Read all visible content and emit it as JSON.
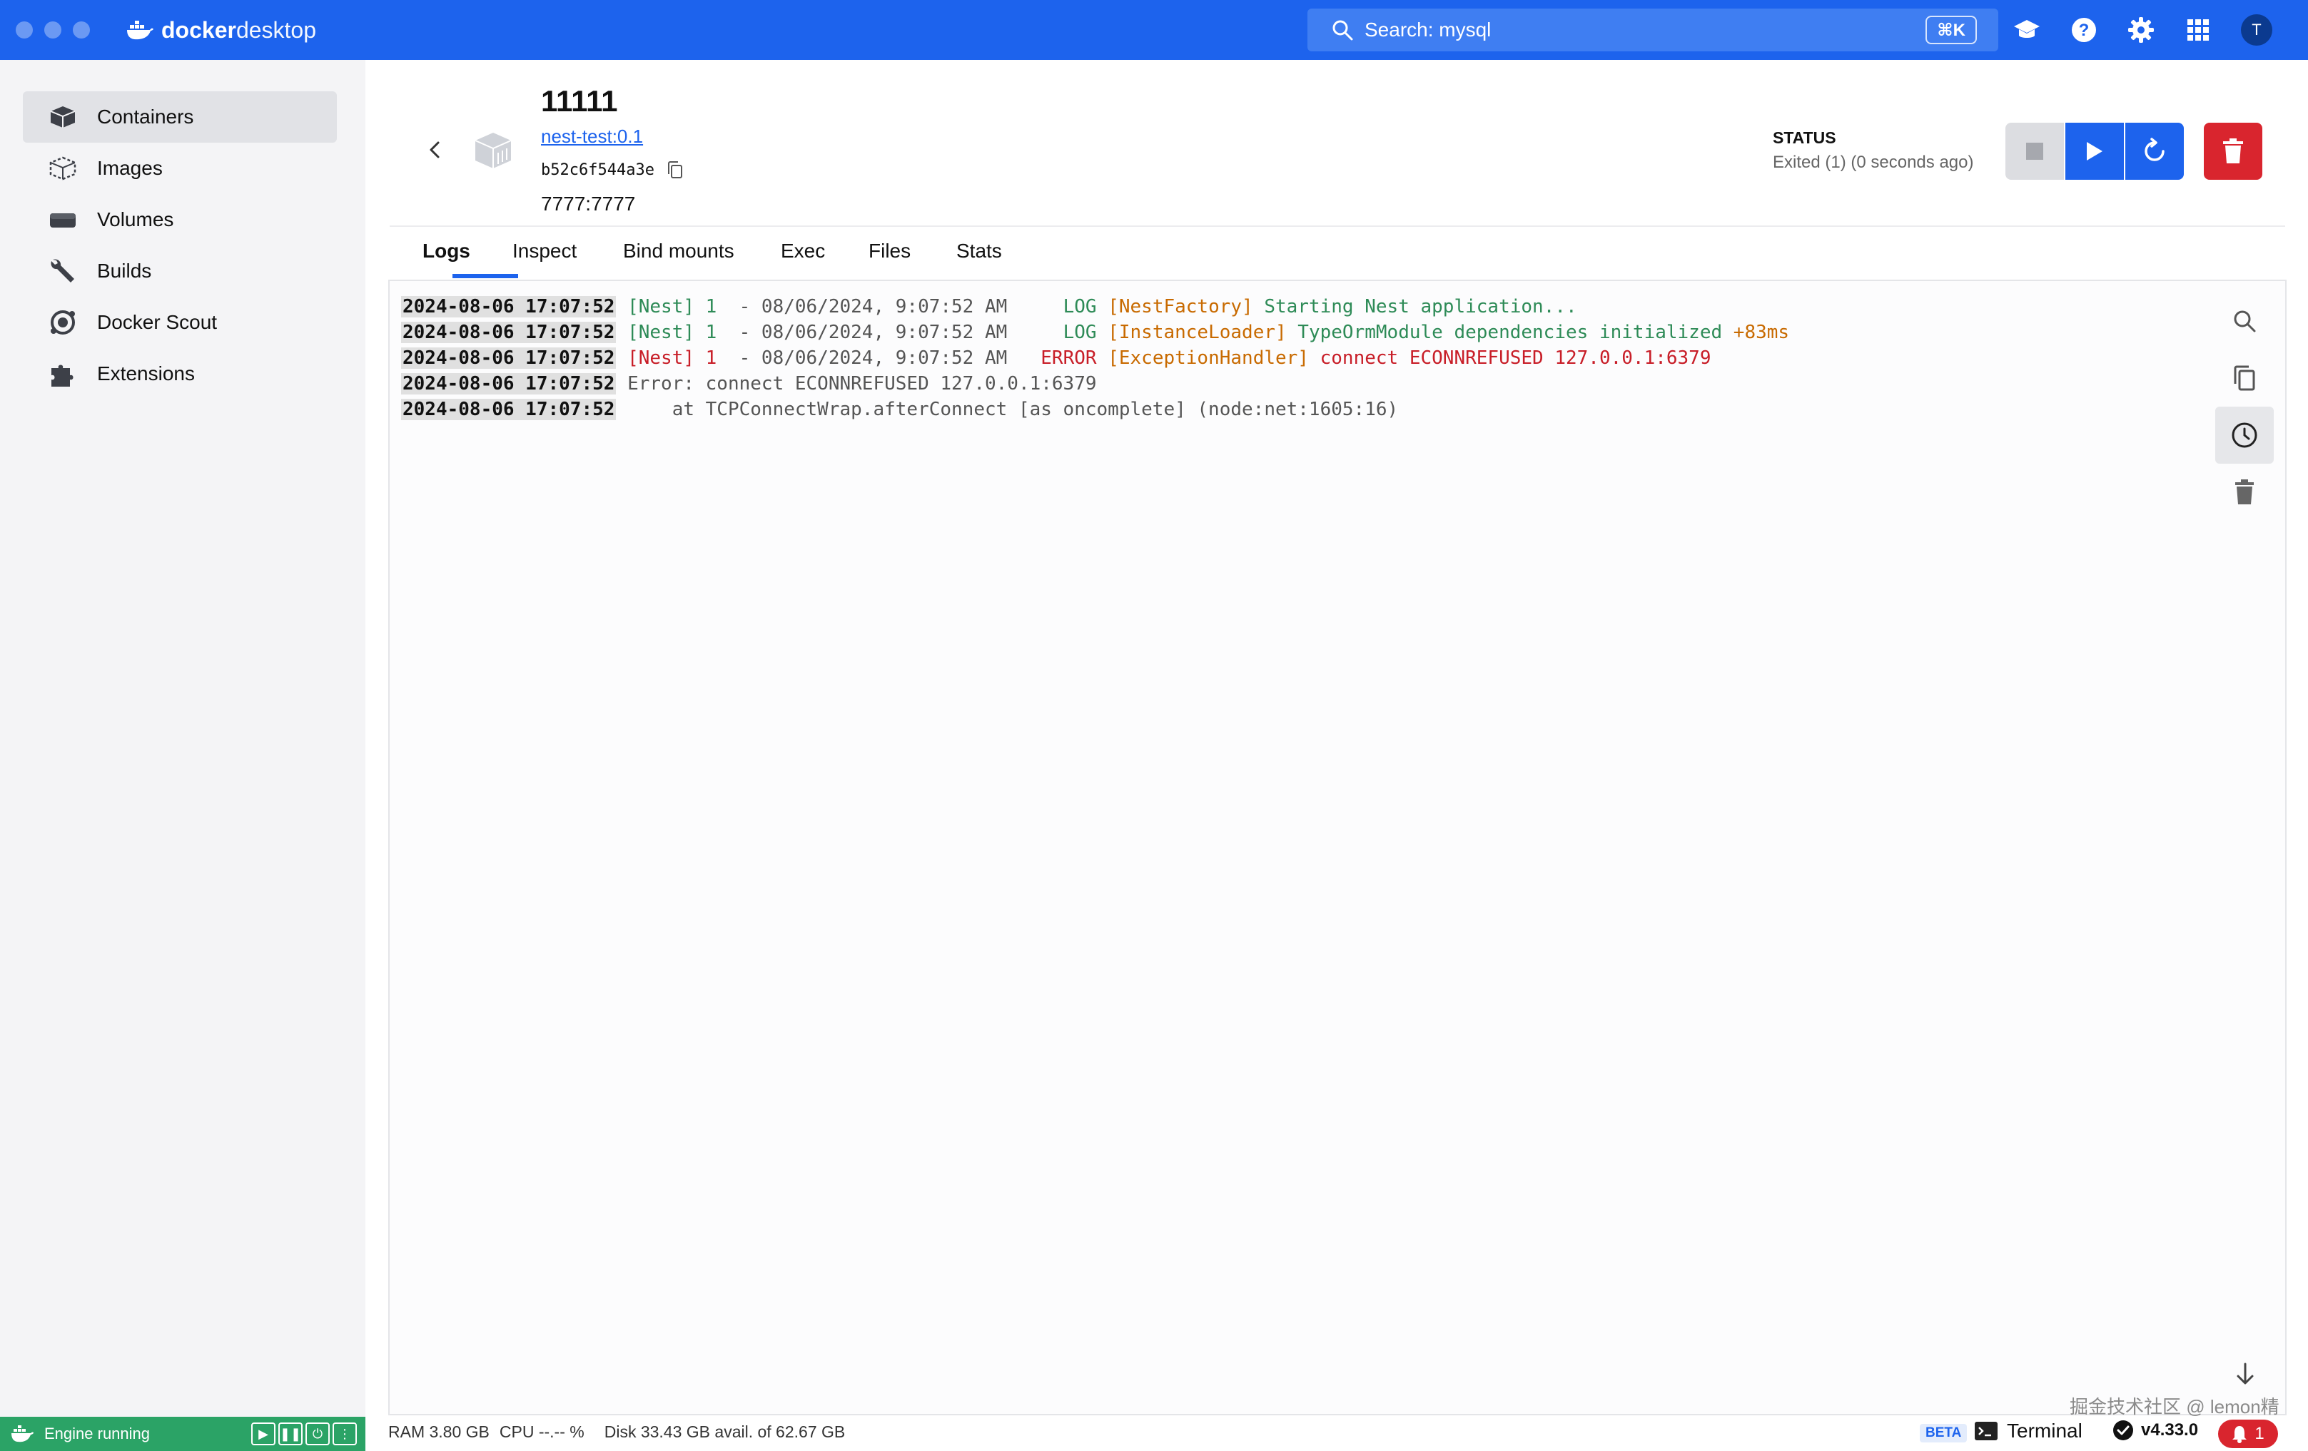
{
  "app": {
    "name_bold": "docker",
    "name_rest": " desktop"
  },
  "search": {
    "text": "Search: mysql",
    "shortcut": "⌘K"
  },
  "user": {
    "initial": "T"
  },
  "sidebar": {
    "items": [
      {
        "label": "Containers",
        "icon": "container-icon",
        "active": true
      },
      {
        "label": "Images",
        "icon": "image-icon"
      },
      {
        "label": "Volumes",
        "icon": "volume-icon"
      },
      {
        "label": "Builds",
        "icon": "wrench-icon"
      },
      {
        "label": "Docker Scout",
        "icon": "scout-icon"
      },
      {
        "label": "Extensions",
        "icon": "puzzle-icon"
      }
    ]
  },
  "container": {
    "name": "11111",
    "image": "nest-test:0.1",
    "id": "b52c6f544a3e",
    "ports": "7777:7777"
  },
  "status": {
    "label": "STATUS",
    "value": "Exited (1) (0 seconds ago)"
  },
  "tabs": [
    "Logs",
    "Inspect",
    "Bind mounts",
    "Exec",
    "Files",
    "Stats"
  ],
  "logs": [
    {
      "ts": "2024-08-06 17:07:52",
      "prefix": "[Nest] 1",
      "mid": "  - 08/06/2024, 9:07:52 AM     ",
      "level": "LOG",
      "ctx": "[NestFactory]",
      "msg": " Starting Nest application...",
      "suffix": ""
    },
    {
      "ts": "2024-08-06 17:07:52",
      "prefix": "[Nest] 1",
      "mid": "  - 08/06/2024, 9:07:52 AM     ",
      "level": "LOG",
      "ctx": "[InstanceLoader]",
      "msg": " TypeOrmModule dependencies initialized",
      "suffix": " +83ms"
    },
    {
      "ts": "2024-08-06 17:07:52",
      "prefix": "[Nest] 1",
      "mid": "  - 08/06/2024, 9:07:52 AM   ",
      "level": "ERROR",
      "ctx": "[ExceptionHandler]",
      "msg": " connect ECONNREFUSED 127.0.0.1:6379",
      "suffix": ""
    },
    {
      "ts": "2024-08-06 17:07:52",
      "plain": "Error: connect ECONNREFUSED 127.0.0.1:6379"
    },
    {
      "ts": "2024-08-06 17:07:52",
      "plain": "    at TCPConnectWrap.afterConnect [as oncomplete] (node:net:1605:16)"
    }
  ],
  "footer": {
    "engine": "Engine running",
    "ram": "RAM 3.80 GB",
    "cpu": "CPU --.-- %",
    "disk": "Disk 33.43 GB avail. of 62.67 GB",
    "beta": "BETA",
    "terminal": "Terminal",
    "version": "v4.33.0",
    "notifications": "1"
  },
  "watermark": "掘金技术社区 @ lemon精",
  "colors": {
    "brand_blue": "#1d63ed",
    "danger_red": "#d9252e",
    "engine_green": "#2ba366"
  }
}
